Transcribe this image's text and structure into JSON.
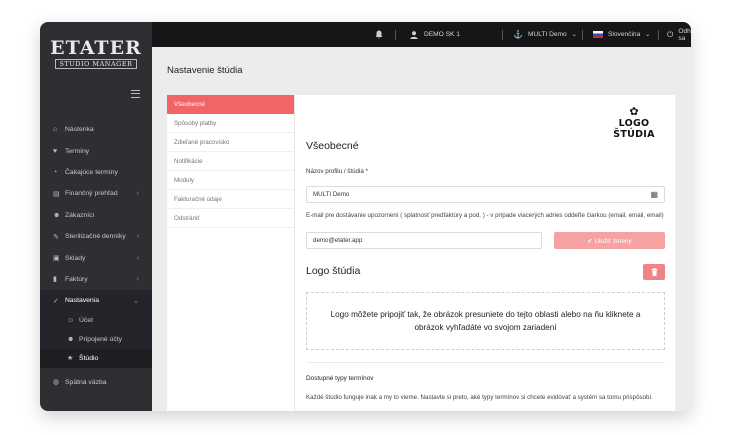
{
  "sidebar": {
    "logo_title": "ETATER",
    "logo_subtitle": "STUDIO MANAGER",
    "items": [
      {
        "icon": "home-icon",
        "glyph": "⌂",
        "label": "Nástenka"
      },
      {
        "icon": "heart-icon",
        "glyph": "♥",
        "label": "Termíny"
      },
      {
        "icon": "clock-icon",
        "glyph": "◔",
        "label": "Čakajúce termíny"
      },
      {
        "icon": "chart-icon",
        "glyph": "▤",
        "label": "Finančný prehľad",
        "caret": "‹"
      },
      {
        "icon": "users-icon",
        "glyph": "☻",
        "label": "Zákazníci"
      },
      {
        "icon": "pen-icon",
        "glyph": "✎",
        "label": "Sterilizačné denníky",
        "caret": "‹"
      },
      {
        "icon": "box-icon",
        "glyph": "▣",
        "label": "Sklady",
        "caret": "‹"
      },
      {
        "icon": "file-icon",
        "glyph": "▮",
        "label": "Faktúry",
        "caret": "‹"
      },
      {
        "icon": "wrench-icon",
        "glyph": "✓",
        "label": "Nastavenia",
        "caret": "⌄"
      }
    ],
    "subitems": [
      {
        "icon": "user-icon",
        "glyph": "☺",
        "label": "Účet"
      },
      {
        "icon": "accounts-icon",
        "glyph": "☻",
        "label": "Pripojené účty"
      },
      {
        "icon": "star-icon",
        "glyph": "★",
        "label": "Štúdio"
      }
    ],
    "feedback": {
      "icon": "feedback-icon",
      "glyph": "◍",
      "label": "Spätná väzba"
    }
  },
  "topbar": {
    "user": "DEMO SK 1",
    "studio": "MULTI Demo",
    "language": "Slovenčina",
    "logout": "Odhlásiť sa"
  },
  "page": {
    "title": "Nastavenie štúdia",
    "tabs": [
      "Všeobecné",
      "Spôsoby platby",
      "Zdieľané pracovisko",
      "Notifikácie",
      "Moduly",
      "Fakturačné údaje",
      "Odstrániť"
    ],
    "active_tab": "Všeobecné"
  },
  "general": {
    "studio_logo_text": "LOGO ŠTÚDIA",
    "heading": "Všeobecné",
    "profile_label": "Názov profilu / štúdia",
    "required_mark": "*",
    "profile_value": "MULTI Demo",
    "email_help": "E-mail pre dostávanie upozornení ( splatnosť predfaktúry a pod. ) - v prípade viacerých adries oddeľte čiarkou (email, email, email)",
    "email_value": "demo@etater.app",
    "save_label": "✔ Uložiť zmeny"
  },
  "logo_section": {
    "heading": "Logo štúdia",
    "dropzone_text": "Logo môžete pripojiť tak, že obrázok presuniete do tejto oblasti alebo na ňu kliknete a obrázok vyhľadáte vo svojom zariadení"
  },
  "types_section": {
    "heading": "Dostupné typy termínov",
    "description": "Každé štúdio funguje inak a my to vieme. Nastavte si preto, aké typy termínov si chcete evidovať a systém sa tomu prispôsobí."
  },
  "colors": {
    "sidebar_bg": "#2d2f33",
    "topbar_bg": "#151618",
    "accent": "#f26466",
    "save_button": "#f6a2a3"
  }
}
